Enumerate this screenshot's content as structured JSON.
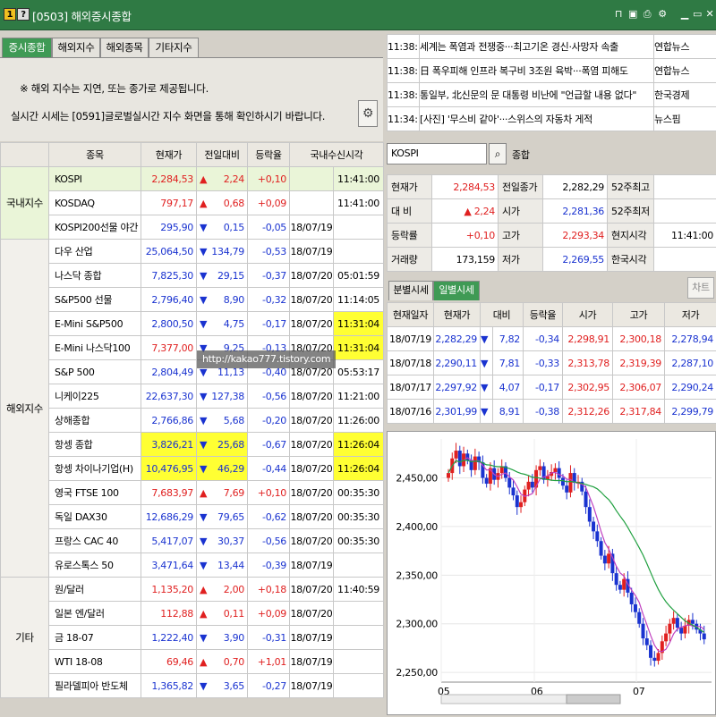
{
  "title": {
    "badge1": "1",
    "badge2": "?",
    "text": "[0503] 해외증시종합"
  },
  "tabs": [
    "증시종합",
    "해외지수",
    "해외종목",
    "기타지수"
  ],
  "notice": {
    "line1": "※ 해외 지수는 지연, 또는 종가로 제공됩니다.",
    "line2": "실시간 시세는 [0591]글로벌실시간 지수 화면을 통해 확인하시기 바랍니다."
  },
  "table": {
    "headers": [
      "종목",
      "현재가",
      "전일대비",
      "등락율",
      "국내수신시각"
    ],
    "groups": {
      "domestic": "국내지수",
      "overseas": "해외지수",
      "other": "기타"
    },
    "rows": [
      {
        "name": "KOSPI",
        "price": "2,284,53",
        "dir": "▲",
        "change": "2,24",
        "rate": "+0,10",
        "date": "",
        "time": "11:41:00",
        "color": "red"
      },
      {
        "name": "KOSDAQ",
        "price": "797,17",
        "dir": "▲",
        "change": "0,68",
        "rate": "+0,09",
        "date": "",
        "time": "11:41:00",
        "color": "red"
      },
      {
        "name": "KOSPI200선물 야간",
        "price": "295,90",
        "dir": "▼",
        "change": "0,15",
        "rate": "-0,05",
        "date": "18/07/19",
        "time": "",
        "color": "blue"
      },
      {
        "name": "다우 산업",
        "price": "25,064,50",
        "dir": "▼",
        "change": "134,79",
        "rate": "-0,53",
        "date": "18/07/19",
        "time": "",
        "color": "blue"
      },
      {
        "name": "나스닥 종합",
        "price": "7,825,30",
        "dir": "▼",
        "change": "29,15",
        "rate": "-0,37",
        "date": "18/07/20",
        "time": "05:01:59",
        "color": "blue"
      },
      {
        "name": "S&P500 선물",
        "price": "2,796,40",
        "dir": "▼",
        "change": "8,90",
        "rate": "-0,32",
        "date": "18/07/20",
        "time": "11:14:05",
        "color": "blue"
      },
      {
        "name": "E-Mini S&P500",
        "price": "2,800,50",
        "dir": "▼",
        "change": "4,75",
        "rate": "-0,17",
        "date": "18/07/20",
        "time": "11:31:04",
        "color": "blue"
      },
      {
        "name": "E-Mini 나스닥100",
        "price": "7,377,00",
        "dir": "▼",
        "change": "9,25",
        "rate": "-0,13",
        "date": "18/07/20",
        "time": "11:31:04",
        "color": "red"
      },
      {
        "name": "S&P 500",
        "price": "2,804,49",
        "dir": "▼",
        "change": "11,13",
        "rate": "-0,40",
        "date": "18/07/20",
        "time": "05:53:17",
        "color": "blue"
      },
      {
        "name": "니케이225",
        "price": "22,637,30",
        "dir": "▼",
        "change": "127,38",
        "rate": "-0,56",
        "date": "18/07/20",
        "time": "11:21:00",
        "color": "blue"
      },
      {
        "name": "상해종합",
        "price": "2,766,86",
        "dir": "▼",
        "change": "5,68",
        "rate": "-0,20",
        "date": "18/07/20",
        "time": "11:26:00",
        "color": "blue"
      },
      {
        "name": "항셍 종합",
        "price": "3,826,21",
        "dir": "▼",
        "change": "25,68",
        "rate": "-0,67",
        "date": "18/07/20",
        "time": "11:26:04",
        "color": "blue"
      },
      {
        "name": "항셍 차이나기업(H)",
        "price": "10,476,95",
        "dir": "▼",
        "change": "46,29",
        "rate": "-0,44",
        "date": "18/07/20",
        "time": "11:26:04",
        "color": "blue"
      },
      {
        "name": "영국 FTSE 100",
        "price": "7,683,97",
        "dir": "▲",
        "change": "7,69",
        "rate": "+0,10",
        "date": "18/07/20",
        "time": "00:35:30",
        "color": "red"
      },
      {
        "name": "독일 DAX30",
        "price": "12,686,29",
        "dir": "▼",
        "change": "79,65",
        "rate": "-0,62",
        "date": "18/07/20",
        "time": "00:35:30",
        "color": "blue"
      },
      {
        "name": "프랑스 CAC 40",
        "price": "5,417,07",
        "dir": "▼",
        "change": "30,37",
        "rate": "-0,56",
        "date": "18/07/20",
        "time": "00:35:30",
        "color": "blue"
      },
      {
        "name": "유로스톡스 50",
        "price": "3,471,64",
        "dir": "▼",
        "change": "13,44",
        "rate": "-0,39",
        "date": "18/07/19",
        "time": "",
        "color": "blue"
      },
      {
        "name": "원/달러",
        "price": "1,135,20",
        "dir": "▲",
        "change": "2,00",
        "rate": "+0,18",
        "date": "18/07/20",
        "time": "11:40:59",
        "color": "red"
      },
      {
        "name": "일본 엔/달러",
        "price": "112,88",
        "dir": "▲",
        "change": "0,11",
        "rate": "+0,09",
        "date": "18/07/20",
        "time": "",
        "color": "red"
      },
      {
        "name": "금 18-07",
        "price": "1,222,40",
        "dir": "▼",
        "change": "3,90",
        "rate": "-0,31",
        "date": "18/07/19",
        "time": "",
        "color": "blue"
      },
      {
        "name": "WTI 18-08",
        "price": "69,46",
        "dir": "▲",
        "change": "0,70",
        "rate": "+1,01",
        "date": "18/07/19",
        "time": "",
        "color": "red"
      },
      {
        "name": "필라델피아 반도체",
        "price": "1,365,82",
        "dir": "▼",
        "change": "3,65",
        "rate": "-0,27",
        "date": "18/07/19",
        "time": "",
        "color": "blue"
      }
    ]
  },
  "watermark": "http://kakao777.tistory.com",
  "news": [
    {
      "time": "11:38:",
      "headline": "세계는 폭염과 전쟁중···최고기온 경신·사망자 속출",
      "source": "연합뉴스"
    },
    {
      "time": "11:38:",
      "headline": "日 폭우피해 인프라 복구비 3조원 육박···폭염 피해도",
      "source": "연합뉴스"
    },
    {
      "time": "11:38:",
      "headline": "통일부, 北신문의 문 대통령 비난에 \"언급할 내용 없다\"",
      "source": "한국경제"
    },
    {
      "time": "11:34:",
      "headline": "[사진] '무스비 같아'···스위스의 자동차 게적",
      "source": "뉴스핌"
    }
  ],
  "search": {
    "value": "KOSPI",
    "label": "종합"
  },
  "quote": [
    [
      "현재가",
      "2,284,53",
      "전일종가",
      "2,282,29",
      "52주최고",
      ""
    ],
    [
      "대 비",
      "▲ 2,24",
      "시가",
      "2,281,36",
      "52주최저",
      ""
    ],
    [
      "등락률",
      "+0,10",
      "고가",
      "2,293,34",
      "현지시각",
      "11:41:00"
    ],
    [
      "거래량",
      "173,159",
      "저가",
      "2,269,55",
      "한국시각",
      ""
    ]
  ],
  "subtabs": [
    "분별시세",
    "일별시세"
  ],
  "chart_button": "차트",
  "daily": {
    "headers": [
      "현재일자",
      "현재가",
      "대비",
      "등락율",
      "시가",
      "고가",
      "저가"
    ],
    "rows": [
      [
        "18/07/19",
        "2,282,29",
        "▼",
        "7,82",
        "-0,34",
        "2,298,91",
        "2,300,18",
        "2,278,94"
      ],
      [
        "18/07/18",
        "2,290,11",
        "▼",
        "7,81",
        "-0,33",
        "2,313,78",
        "2,319,39",
        "2,287,10"
      ],
      [
        "18/07/17",
        "2,297,92",
        "▼",
        "4,07",
        "-0,17",
        "2,302,95",
        "2,306,07",
        "2,290,24"
      ],
      [
        "18/07/16",
        "2,301,99",
        "▼",
        "8,91",
        "-0,38",
        "2,312,26",
        "2,317,84",
        "2,299,79"
      ]
    ]
  },
  "chart_data": {
    "type": "candlestick",
    "y_ticks": [
      "2,450,00",
      "2,400,00",
      "2,350,00",
      "2,300,00",
      "2,250,00"
    ],
    "x_ticks": [
      "05",
      "06",
      "07"
    ],
    "ylim": [
      2240,
      2490
    ],
    "colors": {
      "up": "#e02020",
      "down": "#1a33d0",
      "ma_short": "#c040c0",
      "ma_long": "#20a040"
    }
  }
}
